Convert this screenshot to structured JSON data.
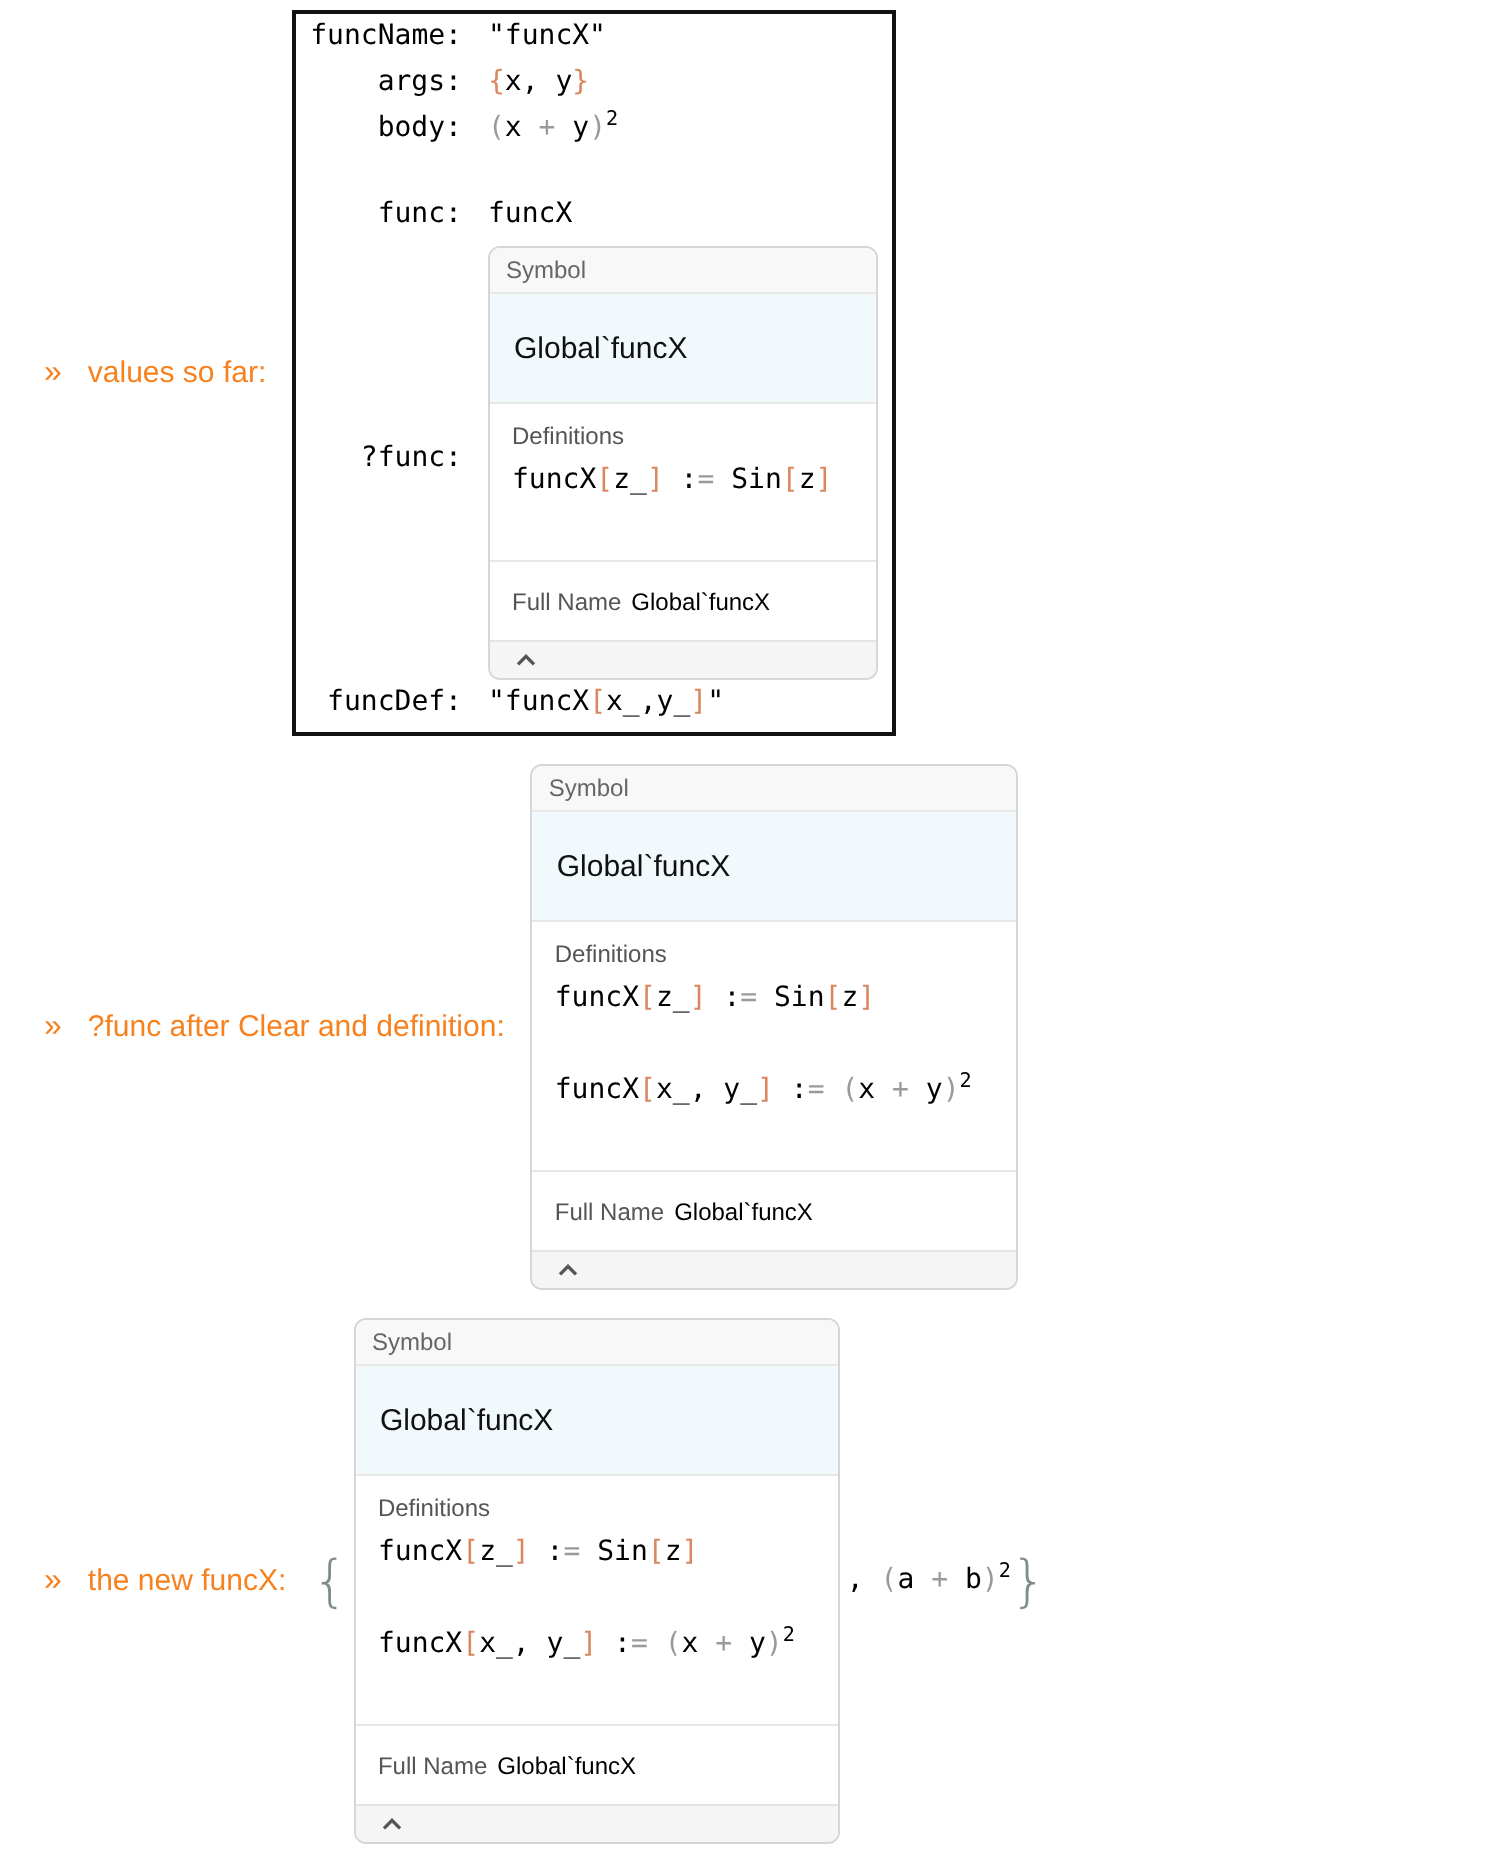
{
  "sections": [
    {
      "marker": "»",
      "label": "values so far:",
      "kind": "grid",
      "rows": [
        {
          "kind": "text",
          "key": "funcName:",
          "value": "\"funcX\""
        },
        {
          "kind": "text",
          "key": "args:",
          "value": "{x, y}"
        },
        {
          "kind": "text",
          "key": "body:",
          "value": "(x + y)$^{2}$"
        },
        {
          "kind": "blank"
        },
        {
          "kind": "text",
          "key": "func:",
          "value": "funcX"
        },
        {
          "kind": "symbol",
          "key": "?func:",
          "symbol": {
            "header": "Symbol",
            "name": "Global`funcX",
            "definitions_label": "Definitions",
            "definitions": [
              "funcX[z_] := Sin[z]"
            ],
            "full_name_label": "Full Name",
            "full_name": "Global`funcX",
            "expanded": true
          }
        },
        {
          "kind": "text",
          "key": "funcDef:",
          "value": "\"funcX[x_,y_]\""
        }
      ]
    },
    {
      "marker": "»",
      "label": "?func after Clear and definition:",
      "kind": "symbol",
      "symbol": {
        "header": "Symbol",
        "name": "Global`funcX",
        "definitions_label": "Definitions",
        "definitions": [
          "funcX[z_] := Sin[z]",
          "funcX[x_, y_] := (x + y)$^{2}$"
        ],
        "full_name_label": "Full Name",
        "full_name": "Global`funcX",
        "expanded": true
      }
    },
    {
      "marker": "»",
      "label": "the new funcX:",
      "kind": "list",
      "open": "{",
      "symbol": {
        "header": "Symbol",
        "name": "Global`funcX",
        "definitions_label": "Definitions",
        "definitions": [
          "funcX[z_] := Sin[z]",
          "funcX[x_, y_] := (x + y)$^{2}$"
        ],
        "full_name_label": "Full Name",
        "full_name": "Global`funcX",
        "expanded": true
      },
      "rest": ", (a + b)$^{2}$",
      "close": "}"
    }
  ]
}
